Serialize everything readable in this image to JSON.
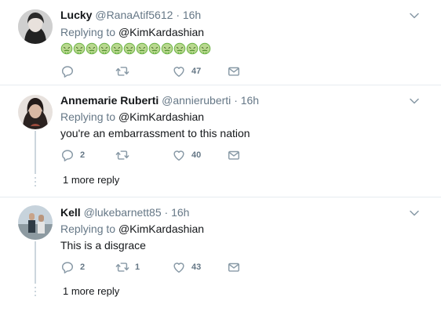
{
  "colors": {
    "icon": "#8899a6",
    "meta": "#657786",
    "separator": "#e6ecf0",
    "emoji_green": "#6ab344"
  },
  "replies": [
    {
      "name": "Lucky",
      "handle": "@RanaAtif5612",
      "time": "· 16h",
      "replying_prefix": "Replying to",
      "replying_to": "@KimKardashian",
      "text": "",
      "emoji": "face-vomiting",
      "emoji_count": 12,
      "replies": "",
      "retweets": "",
      "likes": "47",
      "more_replies": ""
    },
    {
      "name": "Annemarie Ruberti",
      "handle": "@annieruberti",
      "time": "· 16h",
      "replying_prefix": "Replying to",
      "replying_to": "@KimKardashian",
      "text": "you're an embarrassment to this nation",
      "replies": "2",
      "retweets": "",
      "likes": "40",
      "more_replies": "1 more reply"
    },
    {
      "name": "Kell",
      "handle": "@lukebarnett85",
      "time": "· 16h",
      "replying_prefix": "Replying to",
      "replying_to": "@KimKardashian",
      "text": "This is a disgrace",
      "replies": "2",
      "retweets": "1",
      "likes": "43",
      "more_replies": "1 more reply"
    }
  ]
}
